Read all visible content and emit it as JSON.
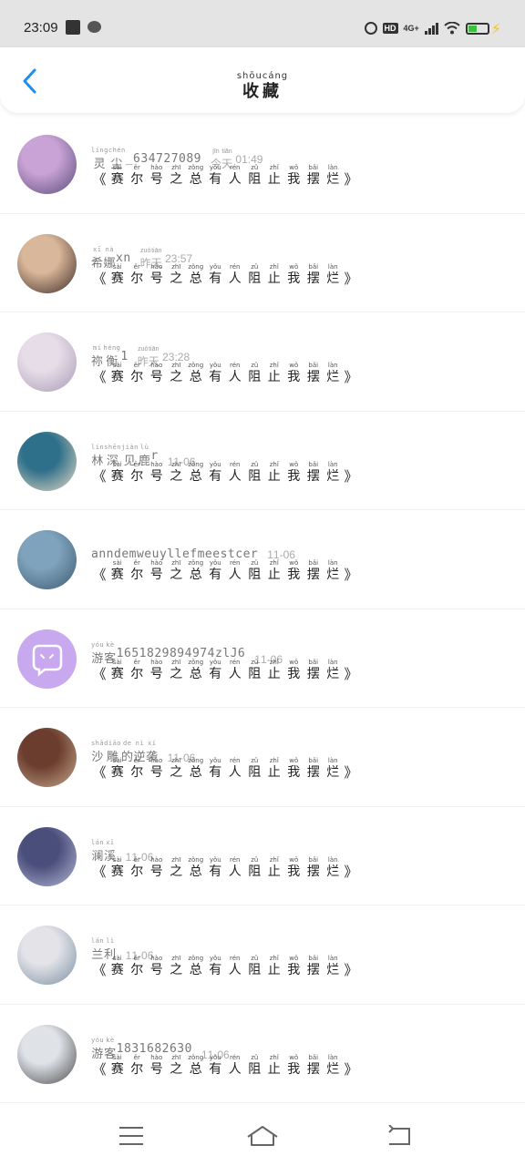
{
  "status_bar": {
    "time": "23:09",
    "network": "4G+",
    "hd": "HD"
  },
  "header": {
    "title": "收藏",
    "title_pinyin": "shōucáng",
    "back_icon": "chevron-left-icon",
    "accent_color": "#1f8ef1"
  },
  "list": [
    {
      "name": "灵尘_634727089",
      "time": "今天 01:49",
      "title_chars": [
        "赛",
        "尔",
        "号",
        "之",
        "总",
        "有",
        "人",
        "阻",
        "止",
        "我",
        "摆",
        "烂"
      ],
      "avatar_color": [
        "#c9a3d6",
        "#5a4b7a"
      ]
    },
    {
      "name": "希娜xn",
      "time": "昨天 23:57",
      "title_chars": [
        "赛",
        "尔",
        "号",
        "之",
        "总",
        "有",
        "人",
        "阻",
        "止",
        "我",
        "摆",
        "烂"
      ],
      "avatar_color": [
        "#d9b79a",
        "#3d2b25"
      ]
    },
    {
      "name": "祢衡1",
      "time": "昨天 23:28",
      "title_chars": [
        "赛",
        "尔",
        "号",
        "之",
        "总",
        "有",
        "人",
        "阻",
        "止",
        "我",
        "摆",
        "烂"
      ],
      "avatar_color": [
        "#e6dde8",
        "#a79bb5"
      ]
    },
    {
      "name": "林深见鹿r",
      "time": "11-06",
      "title_chars": [
        "赛",
        "尔",
        "号",
        "之",
        "总",
        "有",
        "人",
        "阻",
        "止",
        "我",
        "摆",
        "烂"
      ],
      "avatar_color": [
        "#2e6f8a",
        "#e8dcc6"
      ]
    },
    {
      "name": "anndemweuyllefmeestcer",
      "time": "11-06",
      "title_chars": [
        "赛",
        "尔",
        "号",
        "之",
        "总",
        "有",
        "人",
        "阻",
        "止",
        "我",
        "摆",
        "烂"
      ],
      "avatar_color": [
        "#7fa3bd",
        "#3c5a70"
      ]
    },
    {
      "name": "游客1651829894974zlJ6",
      "time": "11-06",
      "title_chars": [
        "赛",
        "尔",
        "号",
        "之",
        "总",
        "有",
        "人",
        "阻",
        "止",
        "我",
        "摆",
        "烂"
      ],
      "avatar_color": [
        "#c8a8ef",
        "#b692ea"
      ]
    },
    {
      "name": "沙雕的逆袭",
      "time": "11-06",
      "title_chars": [
        "赛",
        "尔",
        "号",
        "之",
        "总",
        "有",
        "人",
        "阻",
        "止",
        "我",
        "摆",
        "烂"
      ],
      "avatar_color": [
        "#6b3d2e",
        "#c6a98e"
      ]
    },
    {
      "name": "澜溪",
      "time": "11-06",
      "title_chars": [
        "赛",
        "尔",
        "号",
        "之",
        "总",
        "有",
        "人",
        "阻",
        "止",
        "我",
        "摆",
        "烂"
      ],
      "avatar_color": [
        "#4a4e7a",
        "#b6b8d8"
      ]
    },
    {
      "name": "兰利",
      "time": "11-06",
      "title_chars": [
        "赛",
        "尔",
        "号",
        "之",
        "总",
        "有",
        "人",
        "阻",
        "止",
        "我",
        "摆",
        "烂"
      ],
      "avatar_color": [
        "#e3e3e8",
        "#7a8fa3"
      ]
    },
    {
      "name": "游客1831682630",
      "time": "11-06",
      "title_chars": [
        "赛",
        "尔",
        "号",
        "之",
        "总",
        "有",
        "人",
        "阻",
        "止",
        "我",
        "摆",
        "烂"
      ],
      "avatar_color": [
        "#dfe3e8",
        "#4a4a4a"
      ]
    }
  ],
  "title_pinyin": [
    "sài",
    "ěr",
    "hào",
    "zhī",
    "zǒng",
    "yǒu",
    "rén",
    "zǔ",
    "zhǐ",
    "wǒ",
    "bǎi",
    "làn"
  ],
  "name_pinyin": [
    [
      [
        "líng",
        "灵"
      ],
      [
        "chén",
        "尘"
      ]
    ],
    [
      [
        "xī",
        "希"
      ],
      [
        "nà",
        "娜"
      ]
    ],
    [
      [
        "mí",
        "祢"
      ],
      [
        "héng",
        "衡"
      ]
    ],
    [
      [
        "lín",
        "林"
      ],
      [
        "shēn",
        "深"
      ],
      [
        "jiàn",
        "见"
      ],
      [
        "lù",
        "鹿"
      ]
    ],
    [],
    [
      [
        "yóu",
        "游"
      ],
      [
        "kè",
        "客"
      ]
    ],
    [
      [
        "shā",
        "沙"
      ],
      [
        "diāo",
        "雕"
      ],
      [
        "de",
        "的"
      ],
      [
        "nì",
        "逆"
      ],
      [
        "xí",
        "袭"
      ]
    ],
    [
      [
        "lán",
        "澜"
      ],
      [
        "xī",
        "溪"
      ]
    ],
    [
      [
        "lán",
        "兰"
      ],
      [
        "lì",
        "利"
      ]
    ],
    [
      [
        "yóu",
        "游"
      ],
      [
        "kè",
        "客"
      ]
    ]
  ],
  "time_pinyin": [
    [
      [
        "jīn",
        "今"
      ],
      [
        "tiān",
        "天"
      ]
    ],
    [
      [
        "zuó",
        "昨"
      ],
      [
        "tiān",
        "天"
      ]
    ],
    [
      [
        "zuó",
        "昨"
      ],
      [
        "tiān",
        "天"
      ]
    ],
    [],
    [],
    [],
    [],
    [],
    [],
    []
  ],
  "nav": {
    "menu_icon": "menu-icon",
    "home_icon": "home-icon",
    "back_icon": "back-arrow-icon"
  }
}
